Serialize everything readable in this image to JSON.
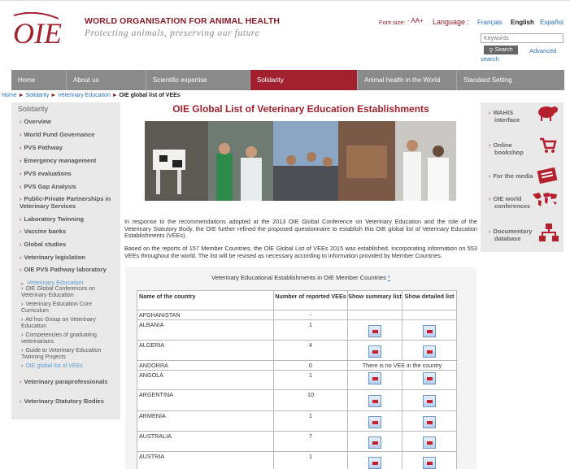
{
  "header": {
    "org_name": "WORLD ORGANISATION FOR ANIMAL HEALTH",
    "tagline": "Protecting animals, preserving our future",
    "logo_text": "OIE",
    "font_size_label": "Font size:",
    "font_size_controls": "- AA+",
    "language_label": "Language :",
    "languages": [
      "Français",
      "English",
      "Español"
    ],
    "search_placeholder": "Keywords",
    "search_button": "Search",
    "advanced_search_1": "Advanced",
    "advanced_search_2": "search"
  },
  "nav": [
    {
      "label": "Home"
    },
    {
      "label": "About us"
    },
    {
      "label": "Scientific expertise"
    },
    {
      "label": "Solidarity",
      "active": true
    },
    {
      "label": "Animal health in the World"
    },
    {
      "label": "Standard Setting"
    }
  ],
  "breadcrumb": {
    "items": [
      "Home",
      "Solidarity",
      "Veterinary Education"
    ],
    "current": "OIE global list of VEEs",
    "separator": "►"
  },
  "sidebar": {
    "title": "Solidarity",
    "items": [
      {
        "label": "Overview"
      },
      {
        "label": "World Fund Governance"
      },
      {
        "label": "PVS Pathway"
      },
      {
        "label": "Emergency management"
      },
      {
        "label": "PVS evaluations"
      },
      {
        "label": "PVS Gap Analysis"
      },
      {
        "label": "Public-Private Partnerships in Veterinary Services"
      },
      {
        "label": "Laboratory Twinning"
      },
      {
        "label": "Vaccine banks"
      },
      {
        "label": "Global studies"
      },
      {
        "label": "Veterinary legislation"
      },
      {
        "label": "OIE PVS Pathway laboratory"
      },
      {
        "label": "Veterinary Education"
      }
    ],
    "subitems": [
      {
        "label": "OIE Global Conferences on Veterinary Education"
      },
      {
        "label": "Veterinary Education Core Curriculum"
      },
      {
        "label": "Ad hoc Group on Veterinary Education"
      },
      {
        "label": "Competencies of graduating veterinarians"
      },
      {
        "label": "Guide to Veterinary Education Twinning Projects"
      },
      {
        "label": "OIE global list of VEEs"
      }
    ],
    "bottom_items": [
      {
        "label": "Veterinary paraprofessionals"
      },
      {
        "label": "Veterinary Statutory Bodies"
      }
    ]
  },
  "main": {
    "title": "OIE Global List of Veterinary Education Establishments",
    "intro_1": "In response to the recommendations adopted at the 2013 OIE Global Conference on Veterinary Education and the role of the Veterinary Statutory Body, the OIE further refined the proposed questionnaire to establish this OIE global list of Veterinary Education Establishments (VEEs).",
    "intro_2": "Based on the reports of 157 Member Countries, the OIE Global List of VEEs 2015 was established, incorporating information on 553 VEEs throughout the world. The list will be revised as necessary according to information provided by Member Countries.",
    "table_caption": "Veterinary Educational Establishments in OIE Member Countries",
    "table_caption_mark": "*",
    "columns": [
      "Name of the country",
      "Number of reported VEEs",
      "Show summary list",
      "Show detailed list"
    ],
    "no_vee_text": "There is no VEE in the country",
    "rows": [
      {
        "country": "AFGHANISTAN",
        "count": "-",
        "mode": "none"
      },
      {
        "country": "ALBANIA",
        "count": "1",
        "mode": "pdf"
      },
      {
        "country": "ALGERIA",
        "count": "4",
        "mode": "pdf"
      },
      {
        "country": "ANDORRA",
        "count": "0",
        "mode": "novee"
      },
      {
        "country": "ANGOLA",
        "count": "1",
        "mode": "pdf"
      },
      {
        "country": "ARGENTINA",
        "count": "10",
        "mode": "pdf"
      },
      {
        "country": "ARMENIA",
        "count": "1",
        "mode": "pdf"
      },
      {
        "country": "AUSTRALIA",
        "count": "7",
        "mode": "pdf"
      },
      {
        "country": "AUSTRIA",
        "count": "1",
        "mode": "pdf"
      }
    ]
  },
  "rightbar": [
    {
      "line1": "WAHIS",
      "line2": "interface",
      "icon": "sheep-icon"
    },
    {
      "line1": "Online",
      "line2": "bookshop",
      "icon": "cart-icon"
    },
    {
      "line1": "For the media",
      "line2": "",
      "icon": "newspaper-icon"
    },
    {
      "line1": "OIE world",
      "line2": "conferences",
      "icon": "world-map-icon"
    },
    {
      "line1": "Documentary",
      "line2": "database",
      "icon": "network-icon"
    }
  ],
  "colors": {
    "brand": "#8c1c2a",
    "nav": "#8a8a8a",
    "nav_active": "#a0202e",
    "link": "#2a6fb3"
  }
}
